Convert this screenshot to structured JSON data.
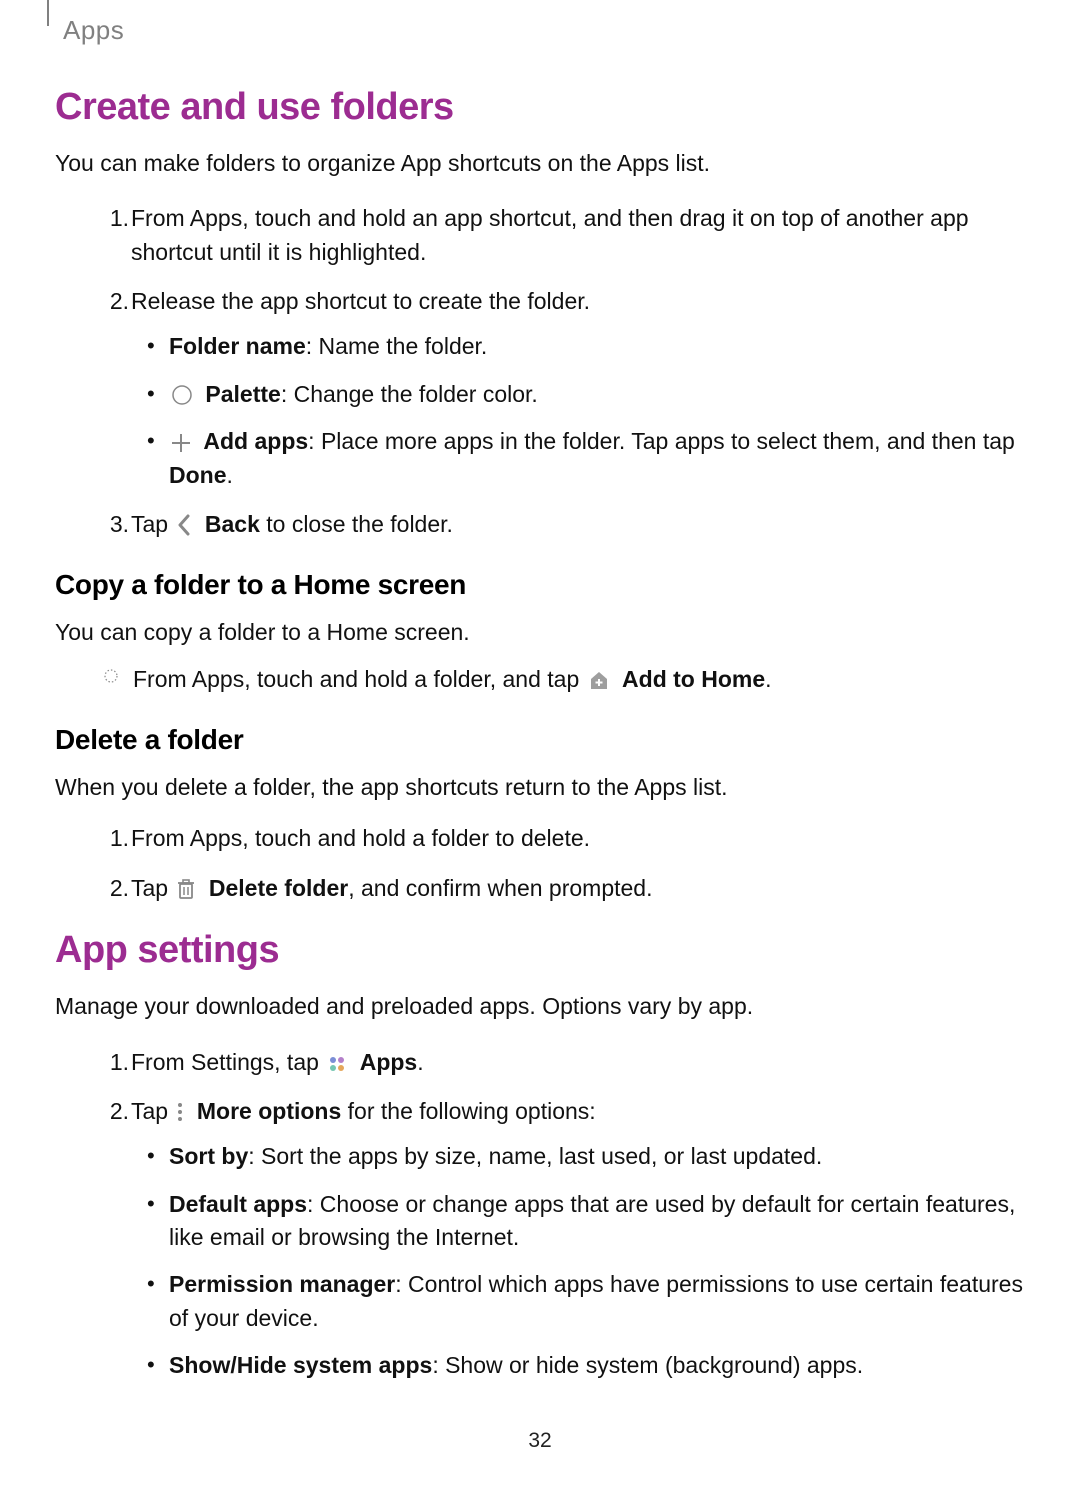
{
  "breadcrumb": {
    "label": "Apps"
  },
  "folders": {
    "title": "Create and use folders",
    "intro": "You can make folders to organize App shortcuts on the Apps list.",
    "step1_num": "1.",
    "step1": "From Apps, touch and hold an app shortcut, and then drag it on top of another app shortcut until it is highlighted.",
    "step2_num": "2.",
    "step2": "Release the app shortcut to create the folder.",
    "step2_b1_label": "Folder name",
    "step2_b1_rest": ": Name the folder.",
    "step2_b2_label": "Palette",
    "step2_b2_rest": ": Change the folder color.",
    "step2_b3_label": "Add apps",
    "step2_b3_rest_a": ": Place more apps in the folder. Tap apps to select them, and then tap ",
    "step2_b3_done": "Done",
    "step2_b3_period": ".",
    "step3_num": "3.",
    "step3_a": "Tap ",
    "step3_back": "Back",
    "step3_b": " to close the folder.",
    "copy": {
      "title": "Copy a folder to a Home screen",
      "intro": "You can copy a folder to a Home screen.",
      "line_a": "From Apps, touch and hold a folder, and tap ",
      "add_home": "Add to Home",
      "period": "."
    },
    "delete": {
      "title": "Delete a folder",
      "intro": "When you delete a folder, the app shortcuts return to the Apps list.",
      "s1_num": "1.",
      "s1": "From Apps, touch and hold a folder to delete.",
      "s2_num": "2.",
      "s2_a": "Tap ",
      "s2_label": "Delete folder",
      "s2_b": ", and confirm when prompted."
    }
  },
  "appsettings": {
    "title": "App settings",
    "intro": "Manage your downloaded and preloaded apps. Options vary by app.",
    "s1_num": "1.",
    "s1_a": "From Settings, tap ",
    "s1_label": "Apps",
    "s1_period": ".",
    "s2_num": "2.",
    "s2_a": "Tap ",
    "s2_label": "More options",
    "s2_b": " for the following options:",
    "b1_label": "Sort by",
    "b1_rest": ": Sort the apps by size, name, last used, or last updated.",
    "b2_label": "Default apps",
    "b2_rest": ": Choose or change apps that are used by default for certain features, like email or browsing the Internet.",
    "b3_label": "Permission manager",
    "b3_rest": ": Control which apps have permissions to use certain features of your device.",
    "b4_label": "Show/Hide system apps",
    "b4_rest": ": Show or hide system (background) apps."
  },
  "page_number": "32"
}
